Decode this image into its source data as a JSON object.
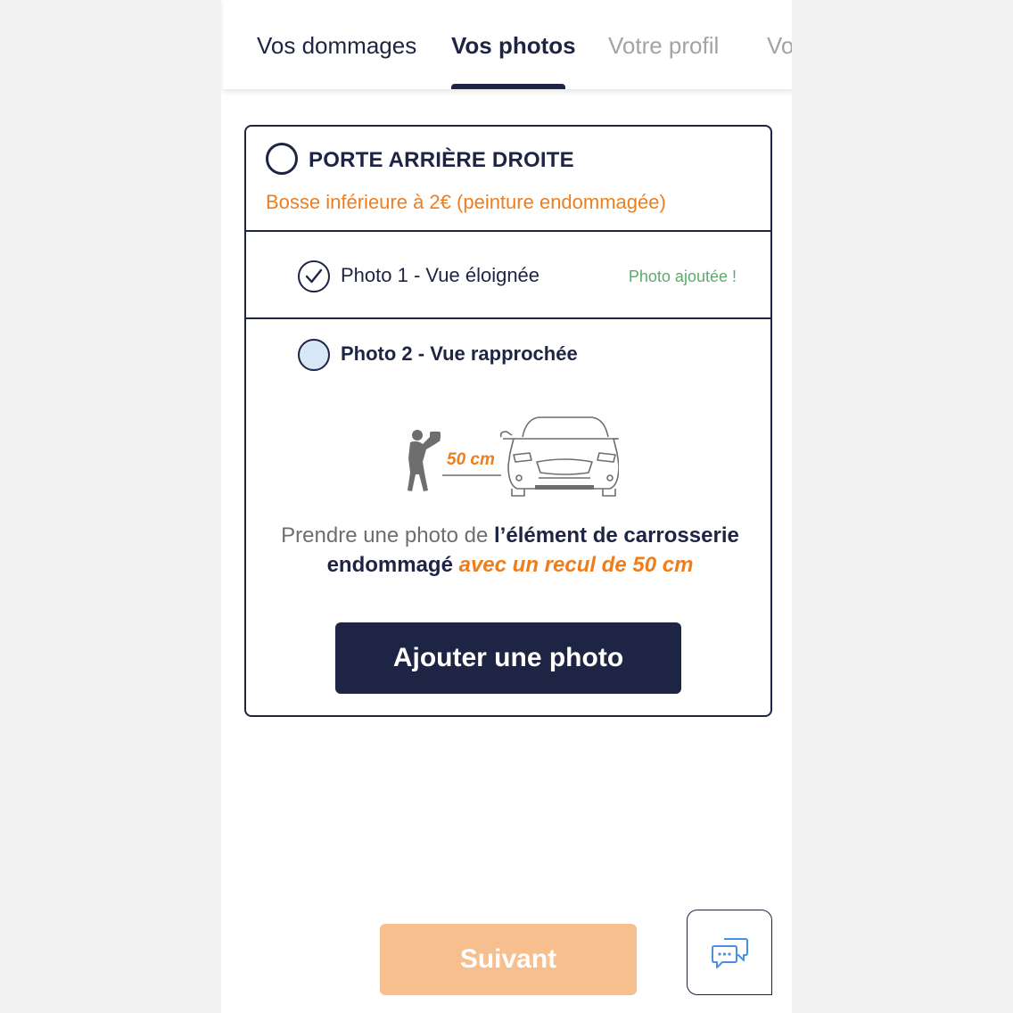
{
  "tabs": [
    {
      "label": "Vos dommages",
      "state": "done"
    },
    {
      "label": "Vos photos",
      "state": "active"
    },
    {
      "label": "Votre profil",
      "state": "upcoming"
    },
    {
      "label": "Vo",
      "state": "upcoming"
    }
  ],
  "card": {
    "part_title": "PORTE ARRIÈRE DROITE",
    "part_subtitle": "Bosse inférieure à 2€ (peinture endommagée)",
    "photo1": {
      "label": "Photo 1 - Vue éloignée",
      "status": "Photo ajoutée !",
      "checked": true
    },
    "photo2": {
      "label": "Photo 2 - Vue rapprochée",
      "selected": true
    },
    "illustration": {
      "distance_label": "50 cm",
      "icon": "photographer-car-icon"
    },
    "instruction": {
      "part1": "Prendre une photo de ",
      "part2": "l’élément de carrosserie endommagé",
      "part3": " avec un recul de 50 cm"
    },
    "add_button": "Ajouter une photo"
  },
  "footer": {
    "next_button": "Suivant",
    "chat_icon": "chat-bubbles-icon"
  },
  "colors": {
    "navy": "#1e2444",
    "orange": "#ef7d1c",
    "green": "#5eaa6c",
    "next_disabled": "#f7be8e",
    "chat_icon": "#4a90e2"
  }
}
